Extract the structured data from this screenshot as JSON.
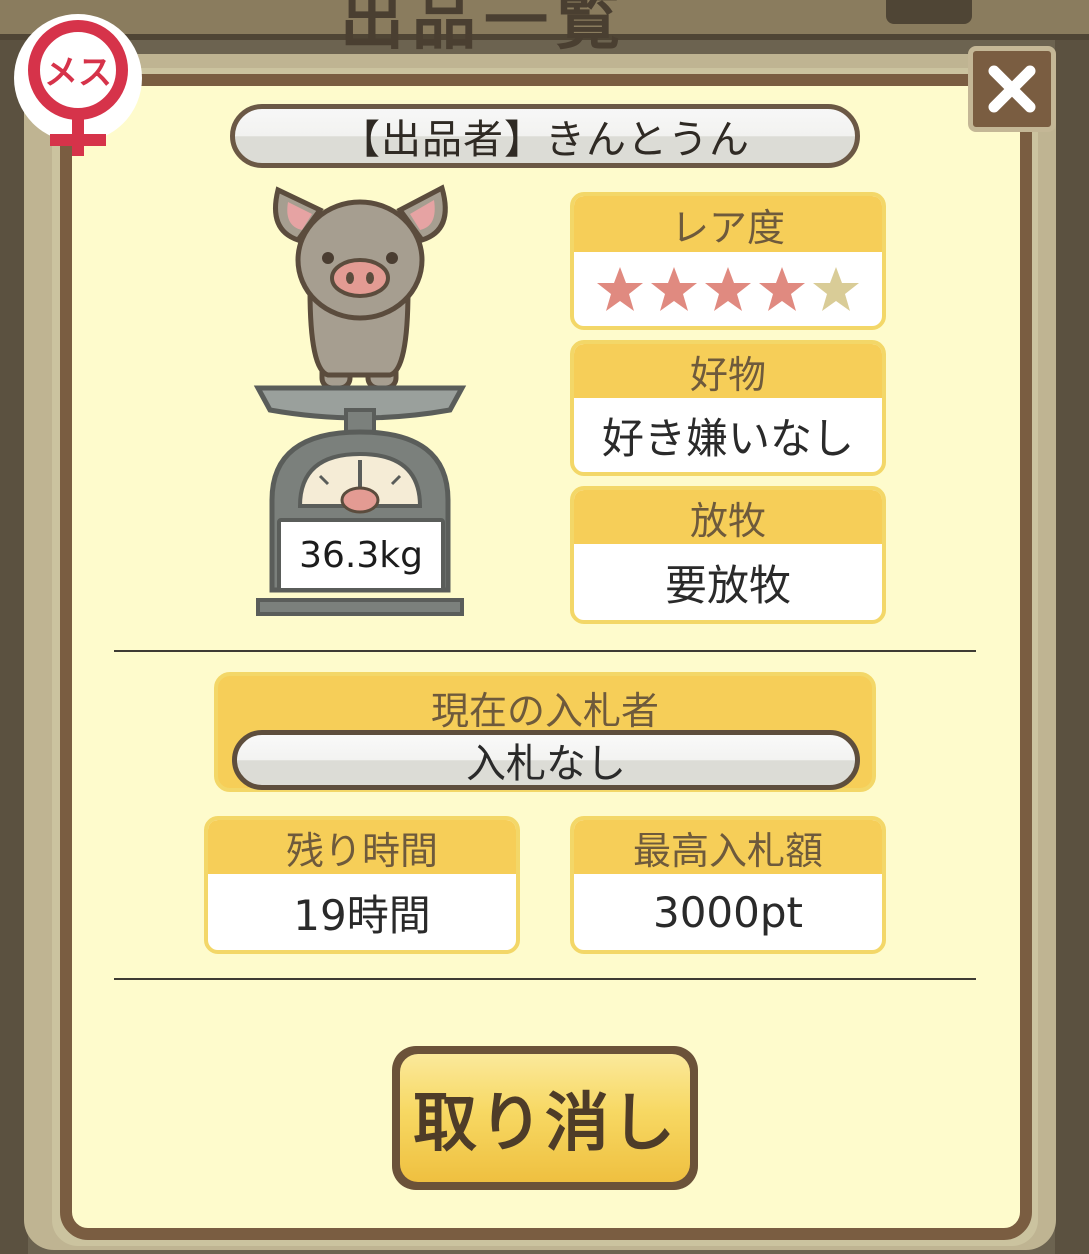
{
  "background": {
    "title": "出品一覧"
  },
  "badge": {
    "gender_label": "メス",
    "gender_icon": "female-symbol-icon"
  },
  "dialog": {
    "seller_label": "【出品者】きんとうん",
    "weight": "36.3kg",
    "rarity": {
      "label": "レア度",
      "rating": 4,
      "max": 5
    },
    "favorite": {
      "label": "好物",
      "value": "好き嫌いなし"
    },
    "grazing": {
      "label": "放牧",
      "value": "要放牧"
    },
    "bidder": {
      "label": "現在の入札者",
      "value": "入札なし"
    },
    "time_left": {
      "label": "残り時間",
      "value": "19時間"
    },
    "max_bid": {
      "label": "最高入札額",
      "value": "3000pt"
    },
    "cancel_label": "取り消し"
  },
  "colors": {
    "panel": "#fefbcc",
    "frame": "#7a5d41",
    "card_header": "#f6ce58",
    "star_filled": "#e08a80",
    "star_empty": "#d9cc97",
    "badge_red": "#d6334a"
  }
}
